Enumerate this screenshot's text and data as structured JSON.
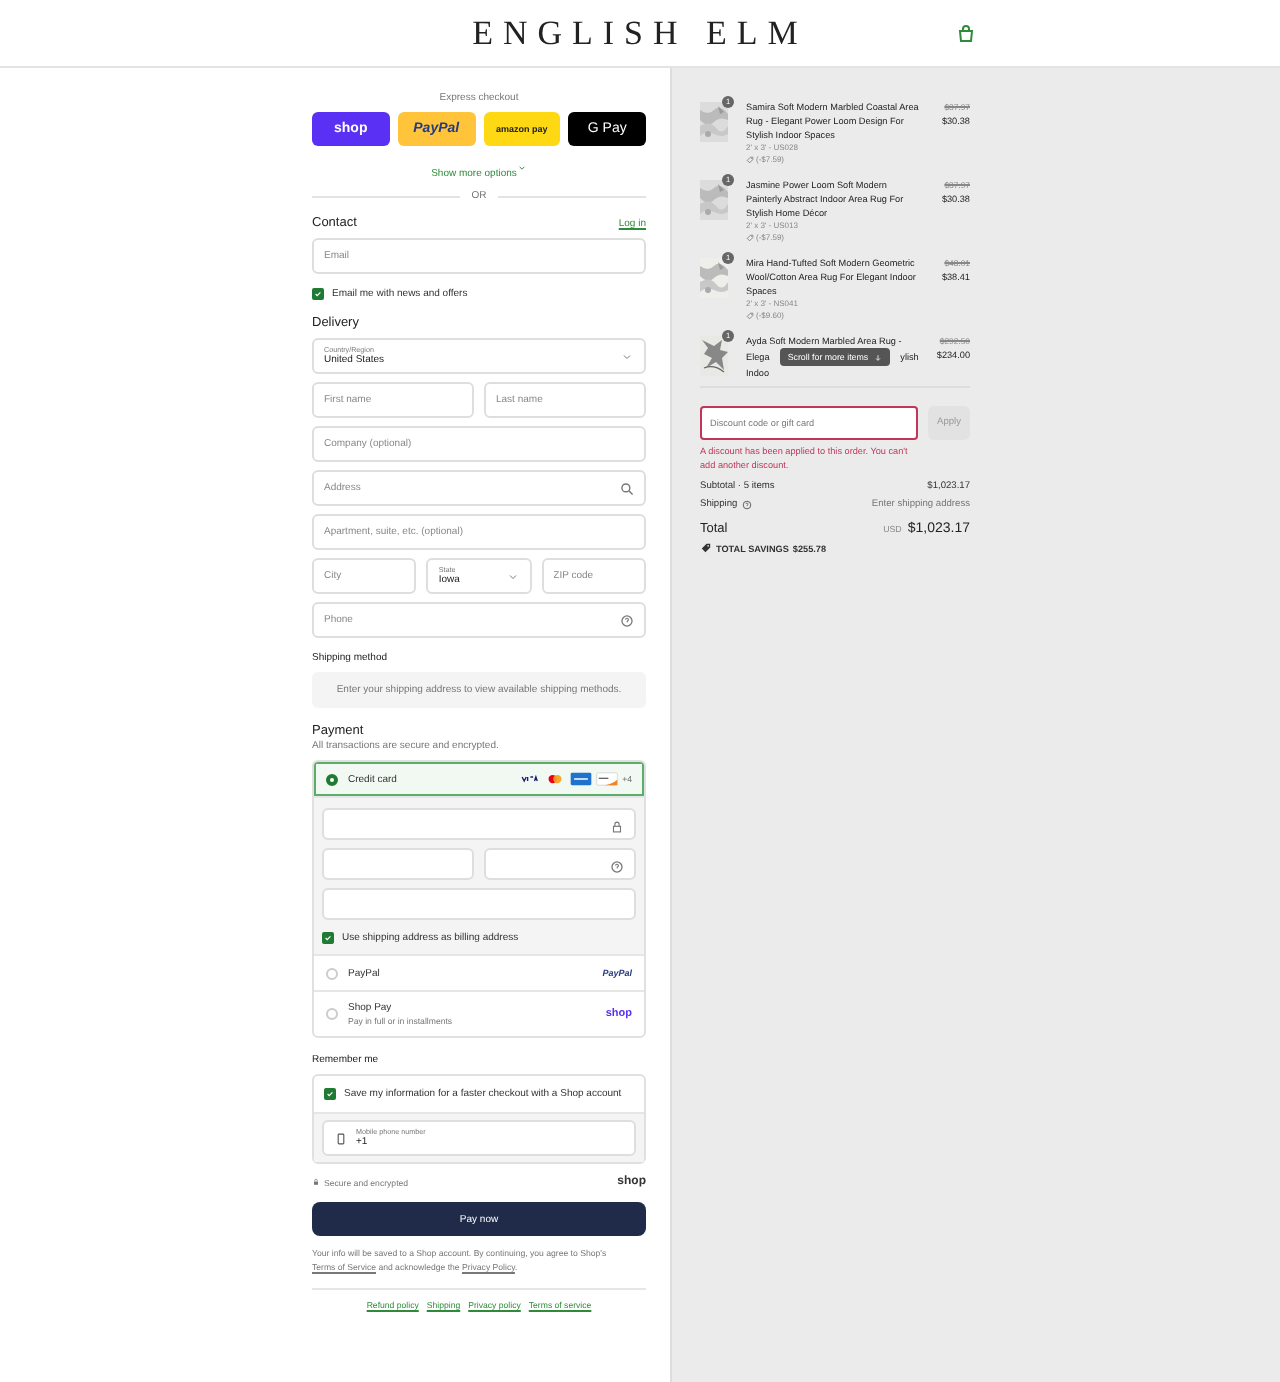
{
  "header": {
    "logo": "ENGLISH ELM"
  },
  "express": {
    "label": "Express checkout",
    "buttons": [
      {
        "kind": "shop",
        "label": "shop"
      },
      {
        "kind": "paypal",
        "label": "PayPal"
      },
      {
        "kind": "amazon",
        "label": "amazon pay"
      },
      {
        "kind": "gpay",
        "label": "G Pay"
      }
    ],
    "more": "Show more options",
    "or": "OR"
  },
  "contact": {
    "title": "Contact",
    "login": "Log in",
    "email": {
      "placeholder": "Email"
    },
    "news": {
      "label": "Email me with news and offers",
      "checked": true
    }
  },
  "delivery": {
    "title": "Delivery",
    "country": {
      "label": "Country/Region",
      "value": "United States"
    },
    "first_name": {
      "placeholder": "First name"
    },
    "last_name": {
      "placeholder": "Last name"
    },
    "company": {
      "placeholder": "Company (optional)"
    },
    "address": {
      "placeholder": "Address"
    },
    "apartment": {
      "placeholder": "Apartment, suite, etc. (optional)"
    },
    "city": {
      "placeholder": "City"
    },
    "state": {
      "label": "State",
      "value": "Iowa"
    },
    "zip": {
      "placeholder": "ZIP code"
    },
    "phone": {
      "placeholder": "Phone"
    }
  },
  "shipping_method": {
    "title": "Shipping method",
    "message": "Enter your shipping address to view available shipping methods."
  },
  "payment": {
    "title": "Payment",
    "subtitle": "All transactions are secure and encrypted.",
    "methods": [
      {
        "kind": "card",
        "label": "Credit card",
        "selected": true,
        "more": "+4"
      },
      {
        "kind": "paypal",
        "label": "PayPal",
        "selected": false,
        "brand": "PayPal"
      },
      {
        "kind": "shoppay",
        "label": "Shop Pay",
        "sublabel": "Pay in full or in installments",
        "selected": false,
        "brand": "shop"
      }
    ],
    "billing": {
      "label": "Use shipping address as billing address",
      "checked": true
    }
  },
  "remember": {
    "title": "Remember me",
    "save": {
      "label": "Save my information for a faster checkout with a Shop account",
      "checked": true
    },
    "phone": {
      "label": "Mobile phone number",
      "value": "+1"
    }
  },
  "secure": {
    "label": "Secure and encrypted",
    "brand": "shop"
  },
  "pay_button": "Pay now",
  "legal": [
    {
      "kind": "text",
      "text": "Your info will be saved to a Shop account. By continuing, you agree to Shop's "
    },
    {
      "kind": "link",
      "text": "Terms of Service"
    },
    {
      "kind": "text",
      "text": " and acknowledge the "
    },
    {
      "kind": "link",
      "text": "Privacy Policy"
    },
    {
      "kind": "text",
      "text": "."
    }
  ],
  "footer_links": [
    "Refund policy",
    "Shipping",
    "Privacy policy",
    "Terms of service"
  ],
  "summary": {
    "items": [
      {
        "quantity": "1",
        "title": "Samira Soft Modern Marbled Coastal Area Rug - Elegant Power Loom Design For Stylish Indoor Spaces",
        "variant": "2' x 3' - US028",
        "discount": "(-$7.59)",
        "compare_price": "$37.97",
        "price": "$30.38"
      },
      {
        "quantity": "1",
        "title": "Jasmine Power Loom Soft Modern Painterly Abstract Indoor Area Rug For Stylish Home Décor",
        "variant": "2' x 3' - US013",
        "discount": "(-$7.59)",
        "compare_price": "$37.97",
        "price": "$30.38"
      },
      {
        "quantity": "1",
        "title": "Mira Hand-Tufted Soft Modern Geometric Wool/Cotton Area Rug For Elegant Indoor Spaces",
        "variant": "2' x 3' - NS041",
        "discount": "(-$9.60)",
        "compare_price": "$48.01",
        "price": "$38.41"
      }
    ],
    "last_item": {
      "quantity": "1",
      "title_line": "Ayda Soft Modern Marbled Area Rug -",
      "left_fragment": "Elega",
      "right_fragment": "ylish",
      "third_fragment": "Indoo",
      "compare_price": "$292.50",
      "price": "$234.00"
    },
    "scroll_hint": "Scroll for more items",
    "discount": {
      "placeholder": "Discount code or gift card",
      "button": "Apply",
      "error": "A discount has been applied to this order. You can't add another discount."
    },
    "subtotal": {
      "label": "Subtotal · 5 items",
      "value": "$1,023.17"
    },
    "shipping": {
      "label": "Shipping",
      "value": "Enter shipping address"
    },
    "total": {
      "label": "Total",
      "currency": "USD",
      "value": "$1,023.17"
    },
    "savings": {
      "label": "TOTAL SAVINGS",
      "value": "$255.78"
    }
  }
}
